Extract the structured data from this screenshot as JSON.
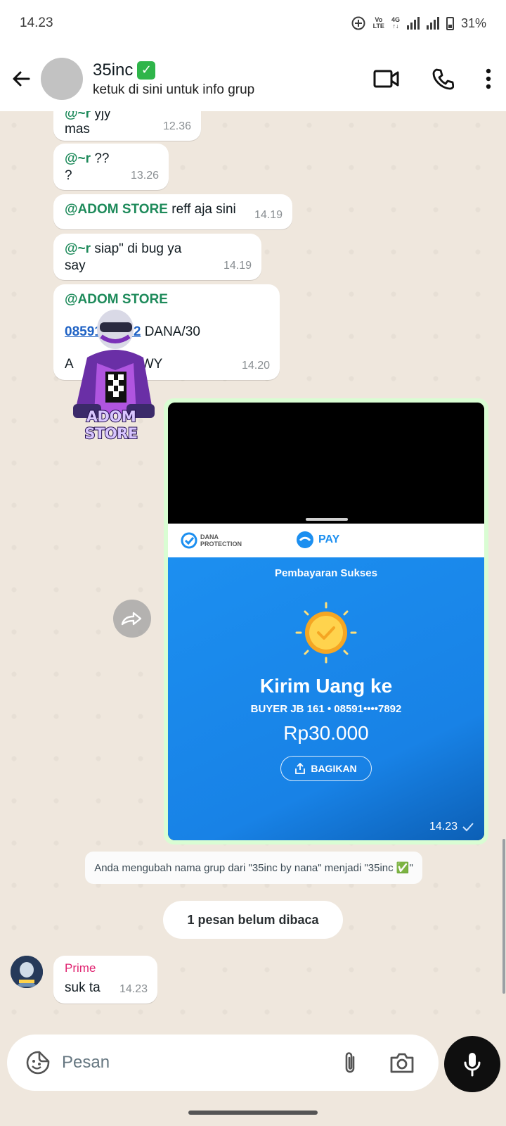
{
  "status_bar": {
    "time": "14.23",
    "network": "VoLTE 4G",
    "battery": "31%"
  },
  "header": {
    "group_name": "35inc",
    "verified": "✓",
    "subtitle": "ketuk di sini untuk info grup"
  },
  "messages": [
    {
      "mention": "@~r",
      "text": "yjy",
      "text2": "mas",
      "time": "12.36"
    },
    {
      "mention": "@~r",
      "text": "??",
      "text2": "?",
      "time": "13.26"
    },
    {
      "mention": "@ADOM STORE",
      "text": "reff aja sini",
      "time": "14.19"
    },
    {
      "mention": "@~r",
      "text": "siap\" di bug ya",
      "text2": "say",
      "time": "14.19"
    },
    {
      "mention": "@ADOM STORE",
      "link": "08591••7892",
      "link_suffix": "DANA/30",
      "text3": "A",
      "text3b": "WY",
      "time": "14.20"
    }
  ],
  "sticker": {
    "caption": "ADOM STORE"
  },
  "payment_image": {
    "brand_left": "DANA PROTECTION",
    "brand_right": "PAY",
    "status": "Pembayaran Sukses",
    "title": "Kirim Uang ke",
    "recipient": "BUYER JB 161 • 08591••••7892",
    "amount": "Rp30.000",
    "share_label": "BAGIKAN",
    "time": "14.23"
  },
  "system_message": "Anda mengubah nama grup dari \"35inc by nana\" menjadi \"35inc ✅\"",
  "unread_banner": "1 pesan belum dibaca",
  "last_message": {
    "sender": "Prime",
    "text": "suk ta",
    "time": "14.23"
  },
  "input": {
    "placeholder": "Pesan"
  },
  "colors": {
    "outgoing_bubble": "#d9fdd3",
    "incoming_bubble": "#ffffff",
    "mention": "#1d8a5a",
    "sender_name": "#e02471",
    "dana_blue": "#1c8ff0"
  }
}
